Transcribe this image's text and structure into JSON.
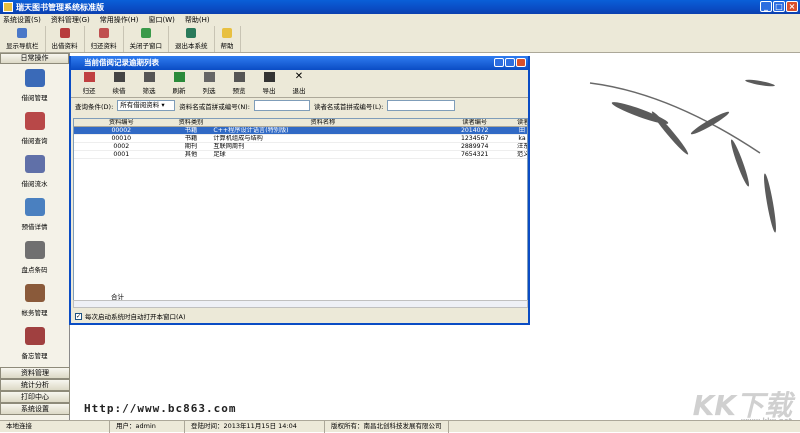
{
  "app": {
    "title": "瑞天图书管理系统标准版"
  },
  "menu": [
    "系统设置(S)",
    "资料管理(G)",
    "常用操作(H)",
    "窗口(W)",
    "帮助(H)"
  ],
  "toolbar": [
    "显示导航栏",
    "出借资料",
    "归还资料",
    "关闭子窗口",
    "退出本系统",
    "帮助"
  ],
  "sidebar": {
    "header": "日常操作",
    "items": [
      "借阅管理",
      "借阅查询",
      "借阅流水",
      "预借详情",
      "盘点条码",
      "帐务管理",
      "备忘管理"
    ],
    "bottom": [
      "资料管理",
      "统计分析",
      "打印中心",
      "系统设置"
    ]
  },
  "child": {
    "title": "当前借阅记录逾期列表",
    "toolbar": [
      "归还",
      "续借",
      "筛选",
      "刷新",
      "列选",
      "预览",
      "导出",
      "退出"
    ],
    "filter": {
      "label1": "查询条件(D):",
      "select": "所有借阅资料",
      "label2": "资料名或首拼或编号(N):",
      "label3": "读者名或首拼或编号(L):"
    },
    "columns": [
      "资料编号",
      "资料类别",
      "资料名称",
      "读者编号",
      "读者"
    ],
    "rows": [
      [
        "00002",
        "书籍",
        "C++程序设计语言(特别版)",
        "2014072",
        "田"
      ],
      [
        "00010",
        "书籍",
        "计算机组成与结构",
        "1234567",
        "ka"
      ],
      [
        "0002",
        "期刊",
        "互联网周刊",
        "2889974",
        "汪东"
      ],
      [
        "0001",
        "其他",
        "足球",
        "7654321",
        "范义"
      ]
    ],
    "total": "合计",
    "autoopen": "每次启动系统时自动打开本窗口(A)"
  },
  "url": "Http://www.bc863.com",
  "brand": "KK下载",
  "brand_url": "www.kkx.net",
  "status": [
    "本地连接",
    "用户：admin",
    "登陆时间：2013年11月15日 14:04",
    "版权所有：南昌北创科技发展有限公司"
  ],
  "colors": {
    "title": "#0a4cc4",
    "selected": "#316ac5"
  }
}
